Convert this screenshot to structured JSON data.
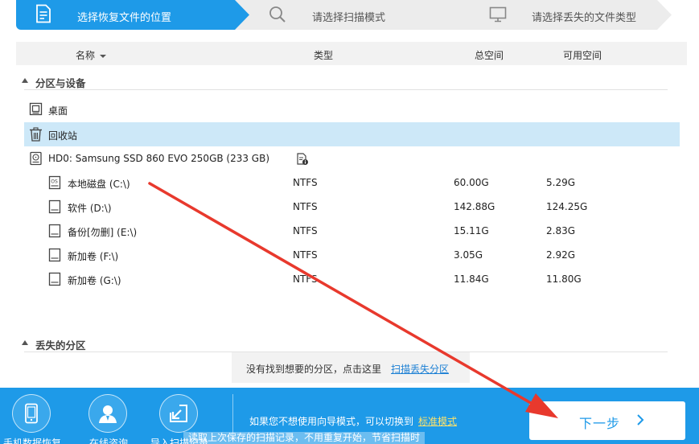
{
  "steps": [
    {
      "label": "选择恢复文件的位置",
      "icon": "document-icon",
      "active": true
    },
    {
      "label": "请选择扫描模式",
      "icon": "search-icon",
      "active": false
    },
    {
      "label": "请选择丢失的文件类型",
      "icon": "monitor-icon",
      "active": false
    }
  ],
  "table_header": {
    "name": "名称",
    "type": "类型",
    "total": "总空间",
    "free": "可用空间"
  },
  "groups": {
    "partitions": "分区与设备",
    "lost": "丢失的分区"
  },
  "locations": [
    {
      "label": "桌面",
      "icon": "desktop-icon"
    },
    {
      "label": "回收站",
      "icon": "recycle-bin-icon"
    }
  ],
  "disk": {
    "label": "HD0: Samsung SSD 860 EVO 250GB (233 GB)",
    "icon": "hard-disk-icon",
    "info_icon": "disk-info-icon"
  },
  "partitions": [
    {
      "name": "本地磁盘 (C:\\)",
      "type": "NTFS",
      "total": "60.00G",
      "free": "5.29G",
      "icon": "system-drive-icon"
    },
    {
      "name": "软件 (D:\\)",
      "type": "NTFS",
      "total": "142.88G",
      "free": "124.25G",
      "icon": "drive-icon"
    },
    {
      "name": "备份[勿删] (E:\\)",
      "type": "NTFS",
      "total": "15.11G",
      "free": "2.83G",
      "icon": "drive-icon"
    },
    {
      "name": "新加卷 (F:\\)",
      "type": "NTFS",
      "total": "3.05G",
      "free": "2.92G",
      "icon": "drive-icon"
    },
    {
      "name": "新加卷 (G:\\)",
      "type": "NTFS",
      "total": "11.84G",
      "free": "11.80G",
      "icon": "drive-icon"
    }
  ],
  "tip": {
    "text": "没有找到想要的分区，点击这里",
    "link": "扫描丢失分区"
  },
  "bottom_tools": [
    {
      "label": "手机数据恢复",
      "icon": "phone-icon"
    },
    {
      "label": "在线咨询",
      "icon": "user-support-icon"
    },
    {
      "label": "导入扫描记录",
      "icon": "import-icon"
    }
  ],
  "mode_switch": {
    "text": "如果您不想使用向导模式，可以切换到",
    "link": "标准模式"
  },
  "tooltip": "读取上次保存的扫描记录，不用重复开始，节省扫描时",
  "next_button": {
    "label": "下一步"
  },
  "colors": {
    "accent": "#1e9ae8",
    "selected_row": "#cde8f8",
    "annotation": "#e8392d",
    "link": "#1a7fd4",
    "mode_link": "#ffe36b"
  }
}
